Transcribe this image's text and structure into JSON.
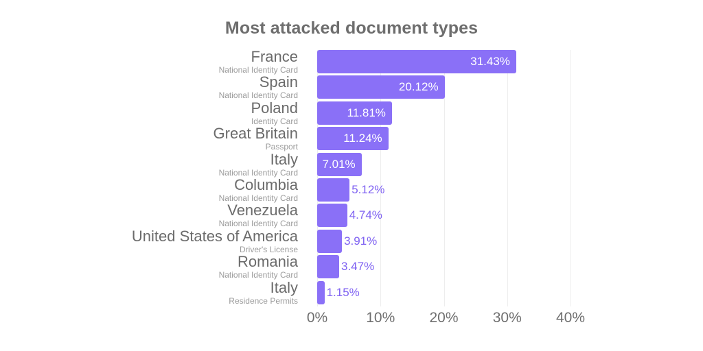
{
  "chart_data": {
    "type": "bar",
    "orientation": "horizontal",
    "title": "Most attacked document types",
    "xlabel": "",
    "ylabel": "",
    "xlim": [
      0,
      40
    ],
    "grid": true,
    "legend": false,
    "accent_color": "#8a70f7",
    "value_label_inside_color": "#ffffff",
    "value_label_outside_color": "#7f62f2",
    "tick_labels": [
      "0%",
      "10%",
      "20%",
      "30%",
      "40%"
    ],
    "tick_values": [
      0,
      10,
      20,
      30,
      40
    ],
    "categories": [
      "France",
      "Spain",
      "Poland",
      "Great Britain",
      "Italy",
      "Columbia",
      "Venezuela",
      "United States of America",
      "Romania",
      "Italy"
    ],
    "subcategories": [
      "National Identity Card",
      "National Identity Card",
      "Identity Card",
      "Passport",
      "National Identity Card",
      "National Identity Card",
      "National Identity Card",
      "Driver's License",
      "National Identity Card",
      "Residence Permits"
    ],
    "values": [
      31.43,
      20.12,
      11.81,
      11.24,
      7.01,
      5.12,
      4.74,
      3.91,
      3.47,
      1.15
    ],
    "value_labels": [
      "31.43%",
      "20.12%",
      "11.81%",
      "11.24%",
      "7.01%",
      "5.12%",
      "4.74%",
      "3.91%",
      "3.47%",
      "1.15%"
    ],
    "label_placement": [
      "inside",
      "inside",
      "inside",
      "inside",
      "inside",
      "outside",
      "outside",
      "outside",
      "outside",
      "outside"
    ]
  }
}
